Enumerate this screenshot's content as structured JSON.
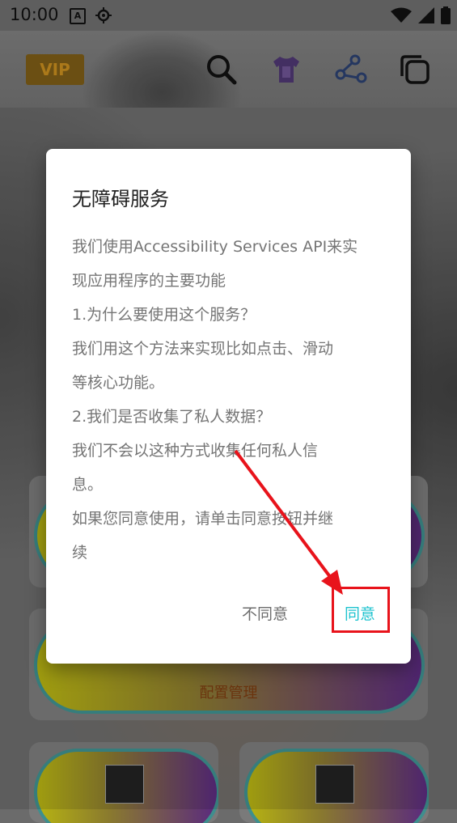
{
  "status_bar": {
    "time": "10:00",
    "a_badge": "A"
  },
  "toolbar": {
    "vip_label": "VIP",
    "icons": [
      "search-icon",
      "tshirt-icon",
      "share-icon",
      "copy-icon"
    ]
  },
  "background": {
    "card_label": "配置管理"
  },
  "dialog": {
    "title": "无障碍服务",
    "lines": [
      "我们使用Accessibility Services API来实",
      "现应用程序的主要功能",
      "1.为什么要使用这个服务？",
      "我们用这个方法来实现比如点击、滑动",
      "等核心功能。",
      "2.我们是否收集了私人数据？",
      "我们不会以这种方式收集任何私人信",
      "息。",
      "如果您同意使用，请单击同意按钮并继",
      "续"
    ],
    "disagree_label": "不同意",
    "agree_label": "同意"
  },
  "colors": {
    "accent": "#1ec3cf",
    "highlight": "#e8131b",
    "vip_text": "#c38a1e"
  }
}
